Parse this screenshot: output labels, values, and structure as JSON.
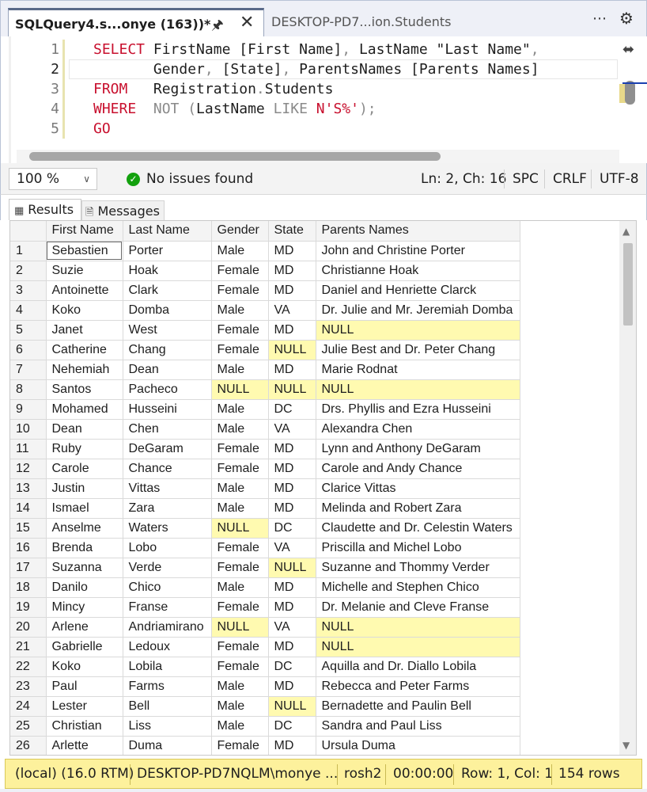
{
  "tabs": {
    "active_title": "SQLQuery4.s...onye (163))*",
    "inactive_title": "DESKTOP-PD7...ion.Students",
    "pin_icon": "pin-icon",
    "close_icon": "close-icon",
    "dropdown_glyph": "⋯",
    "settings_glyph": "⚙"
  },
  "editor": {
    "line_numbers": [
      "1",
      "2",
      "3",
      "4",
      "5"
    ],
    "lines": [
      [
        {
          "t": "SELECT",
          "c": "kw"
        },
        {
          "t": " FirstName [First Name]",
          "c": "nm"
        },
        {
          "t": ",",
          "c": "gr"
        },
        {
          "t": " LastName \"Last Name\"",
          "c": "nm"
        },
        {
          "t": ",",
          "c": "gr"
        }
      ],
      [
        {
          "t": "       Gender",
          "c": "nm"
        },
        {
          "t": ",",
          "c": "gr"
        },
        {
          "t": " [State]",
          "c": "nm"
        },
        {
          "t": ",",
          "c": "gr"
        },
        {
          "t": " ParentsNames [Parents Names]",
          "c": "nm"
        }
      ],
      [
        {
          "t": "FROM",
          "c": "kw"
        },
        {
          "t": "   Registration",
          "c": "nm"
        },
        {
          "t": ".",
          "c": "gr"
        },
        {
          "t": "Students",
          "c": "nm"
        }
      ],
      [
        {
          "t": "WHERE",
          "c": "kw"
        },
        {
          "t": "  NOT (",
          "c": "gr"
        },
        {
          "t": "LastName",
          "c": "nm"
        },
        {
          "t": " LIKE ",
          "c": "gr"
        },
        {
          "t": "N'S%'",
          "c": "st"
        },
        {
          "t": ");",
          "c": "gr"
        }
      ],
      [
        {
          "t": "GO",
          "c": "kw"
        }
      ]
    ]
  },
  "editor_status": {
    "zoom": "100 %",
    "issues": "No issues found",
    "position": "Ln: 2, Ch: 16",
    "whitespace": "SPC",
    "line_ending": "CRLF",
    "encoding": "UTF-8"
  },
  "results_tabs": {
    "results_label": "Results",
    "messages_label": "Messages"
  },
  "grid": {
    "columns": [
      "",
      "First Name",
      "Last Name",
      "Gender",
      "State",
      "Parents Names"
    ],
    "rows": [
      [
        "1",
        "Sebastien",
        "Porter",
        "Male",
        "MD",
        "John and Christine Porter"
      ],
      [
        "2",
        "Suzie",
        "Hoak",
        "Female",
        "MD",
        "Christianne Hoak"
      ],
      [
        "3",
        "Antoinette",
        "Clark",
        "Female",
        "MD",
        "Daniel and Henriette Clarck"
      ],
      [
        "4",
        "Koko",
        "Domba",
        "Male",
        "VA",
        "Dr. Julie and Mr. Jeremiah Domba"
      ],
      [
        "5",
        "Janet",
        "West",
        "Female",
        "MD",
        "NULL"
      ],
      [
        "6",
        "Catherine",
        "Chang",
        "Female",
        "NULL",
        "Julie Best and Dr. Peter Chang"
      ],
      [
        "7",
        "Nehemiah",
        "Dean",
        "Male",
        "MD",
        "Marie Rodnat"
      ],
      [
        "8",
        "Santos",
        "Pacheco",
        "NULL",
        "NULL",
        "NULL"
      ],
      [
        "9",
        "Mohamed",
        "Husseini",
        "Male",
        "DC",
        "Drs. Phyllis and Ezra Husseini"
      ],
      [
        "10",
        "Dean",
        "Chen",
        "Male",
        "VA",
        "Alexandra Chen"
      ],
      [
        "11",
        "Ruby",
        "DeGaram",
        "Female",
        "MD",
        "Lynn and Anthony DeGaram"
      ],
      [
        "12",
        "Carole",
        "Chance",
        "Female",
        "MD",
        "Carole and Andy Chance"
      ],
      [
        "13",
        "Justin",
        "Vittas",
        "Male",
        "MD",
        "Clarice Vittas"
      ],
      [
        "14",
        "Ismael",
        "Zara",
        "Male",
        "MD",
        "Melinda and Robert Zara"
      ],
      [
        "15",
        "Anselme",
        "Waters",
        "NULL",
        "DC",
        "Claudette and Dr. Celestin Waters"
      ],
      [
        "16",
        "Brenda",
        "Lobo",
        "Female",
        "VA",
        "Priscilla and Michel Lobo"
      ],
      [
        "17",
        "Suzanna",
        "Verde",
        "Female",
        "NULL",
        "Suzanne and Thommy Verder"
      ],
      [
        "18",
        "Danilo",
        "Chico",
        "Male",
        "MD",
        "Michelle and Stephen Chico"
      ],
      [
        "19",
        "Mincy",
        "Franse",
        "Female",
        "MD",
        "Dr. Melanie and Cleve Franse"
      ],
      [
        "20",
        "Arlene",
        "Andriamirano",
        "NULL",
        "VA",
        "NULL"
      ],
      [
        "21",
        "Gabrielle",
        "Ledoux",
        "Female",
        "MD",
        "NULL"
      ],
      [
        "22",
        "Koko",
        "Lobila",
        "Female",
        "DC",
        "Aquilla and Dr. Diallo Lobila"
      ],
      [
        "23",
        "Paul",
        "Farms",
        "Male",
        "MD",
        "Rebecca and Peter Farms"
      ],
      [
        "24",
        "Lester",
        "Bell",
        "Male",
        "NULL",
        "Bernadette and Paulin Bell"
      ],
      [
        "25",
        "Christian",
        "Liss",
        "Male",
        "DC",
        "Sandra and Paul Liss"
      ],
      [
        "26",
        "Arlette",
        "Duma",
        "Female",
        "MD",
        "Ursula Duma"
      ]
    ],
    "null_color": "#fffab0",
    "selected_cell": {
      "row": 0,
      "col": 1
    }
  },
  "connection_status": {
    "server": "(local) (16.0 RTM)",
    "login": "DESKTOP-PD7NQLM\\monye ...",
    "database": "rosh2",
    "elapsed": "00:00:00",
    "cursor": "Row: 1, Col: 1",
    "row_count": "154 rows",
    "bar_color": "#fdf19c"
  }
}
